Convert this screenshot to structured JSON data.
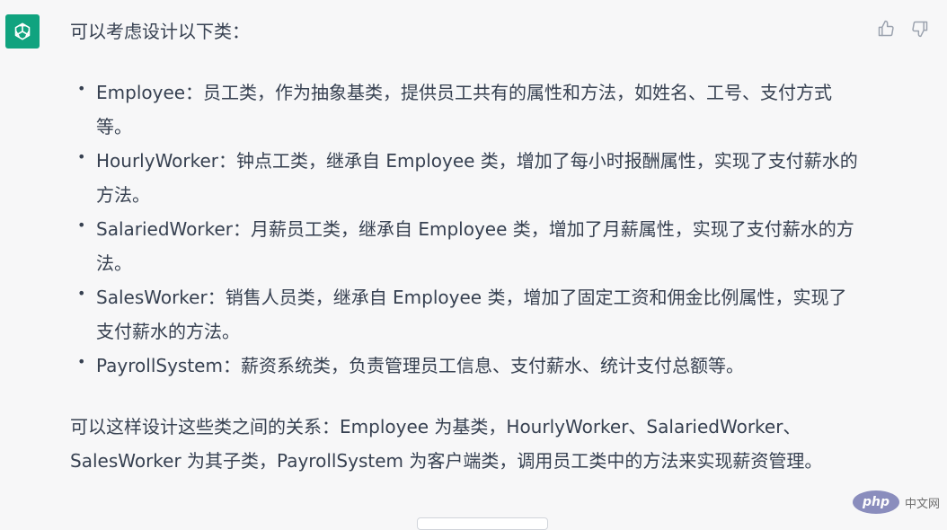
{
  "message": {
    "intro": "可以考虑设计以下类：",
    "classes": [
      "Employee：员工类，作为抽象基类，提供员工共有的属性和方法，如姓名、工号、支付方式等。",
      "HourlyWorker：钟点工类，继承自 Employee 类，增加了每小时报酬属性，实现了支付薪水的方法。",
      "SalariedWorker：月薪员工类，继承自 Employee 类，增加了月薪属性，实现了支付薪水的方法。",
      "SalesWorker：销售人员类，继承自 Employee 类，增加了固定工资和佣金比例属性，实现了支付薪水的方法。",
      "PayrollSystem：薪资系统类，负责管理员工信息、支付薪水、统计支付总额等。"
    ],
    "summary": "可以这样设计这些类之间的关系：Employee 为基类，HourlyWorker、SalariedWorker、SalesWorker 为其子类，PayrollSystem 为客户端类，调用员工类中的方法来实现薪资管理。"
  },
  "bullet": "•",
  "watermark": {
    "logo": "php",
    "site": "中文网"
  },
  "icons": {
    "avatar": "openai-logo-icon",
    "like": "thumbs-up-icon",
    "dislike": "thumbs-down-icon"
  },
  "colors": {
    "avatar_bg": "#10a37f",
    "background": "#f7f7f8",
    "text": "#374151",
    "php_logo": "#777bb3"
  }
}
